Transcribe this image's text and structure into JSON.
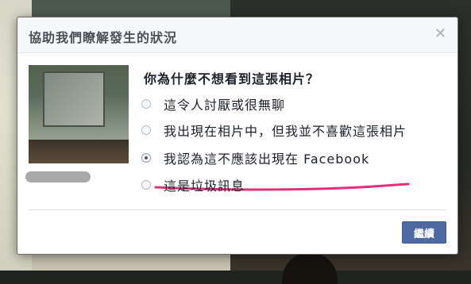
{
  "dialog": {
    "title": "協助我們瞭解發生的狀況",
    "question": "你為什麼不想看到這張相片？",
    "options": [
      {
        "label": "這令人討厭或很無聊",
        "selected": false
      },
      {
        "label": "我出現在相片中，但我並不喜歡這張相片",
        "selected": false
      },
      {
        "label": "我認為這不應該出現在 Facebook",
        "selected": true
      },
      {
        "label": "這是垃圾訊息",
        "selected": false
      }
    ],
    "continue_label": "繼續",
    "close_icon": "close-icon"
  },
  "colors": {
    "accent": "#4e69a2",
    "annotation": "#e0307a",
    "title_text": "#4b4f56"
  }
}
